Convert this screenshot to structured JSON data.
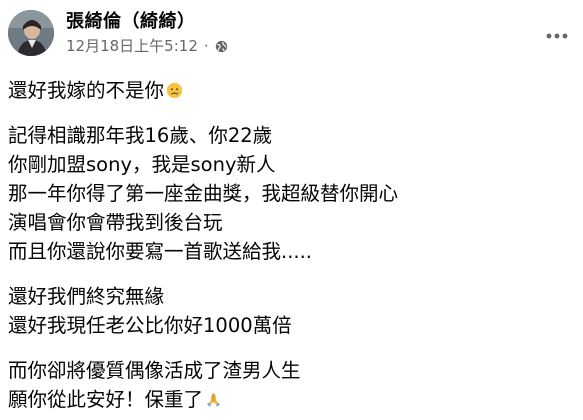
{
  "post": {
    "author": "張綺倫（綺綺）",
    "timestamp": "12月18日上午5:12",
    "separator": "·",
    "audience_icon": "globe-icon",
    "more_icon": "more-options-icon",
    "lines": {
      "l1": "還好我嫁的不是你",
      "l1_emoji": "sad-face-emoji",
      "l2": "記得相識那年我16歲、你22歲",
      "l3": "你剛加盟sony，我是sony新人",
      "l4": "那一年你得了第一座金曲獎，我超級替你開心",
      "l5": "演唱會你會帶我到後台玩",
      "l6": "而且你還說你要寫一首歌送給我.....",
      "l7": "還好我們終究無緣",
      "l8": "還好我現任老公比你好1000萬倍",
      "l9": "而你卻將優質偶像活成了渣男人生",
      "l10": "願你從此安好！保重了",
      "l10_emoji": "folded-hands-emoji"
    }
  },
  "colors": {
    "text_primary": "#050505",
    "text_secondary": "#65676b",
    "background": "#ffffff"
  }
}
